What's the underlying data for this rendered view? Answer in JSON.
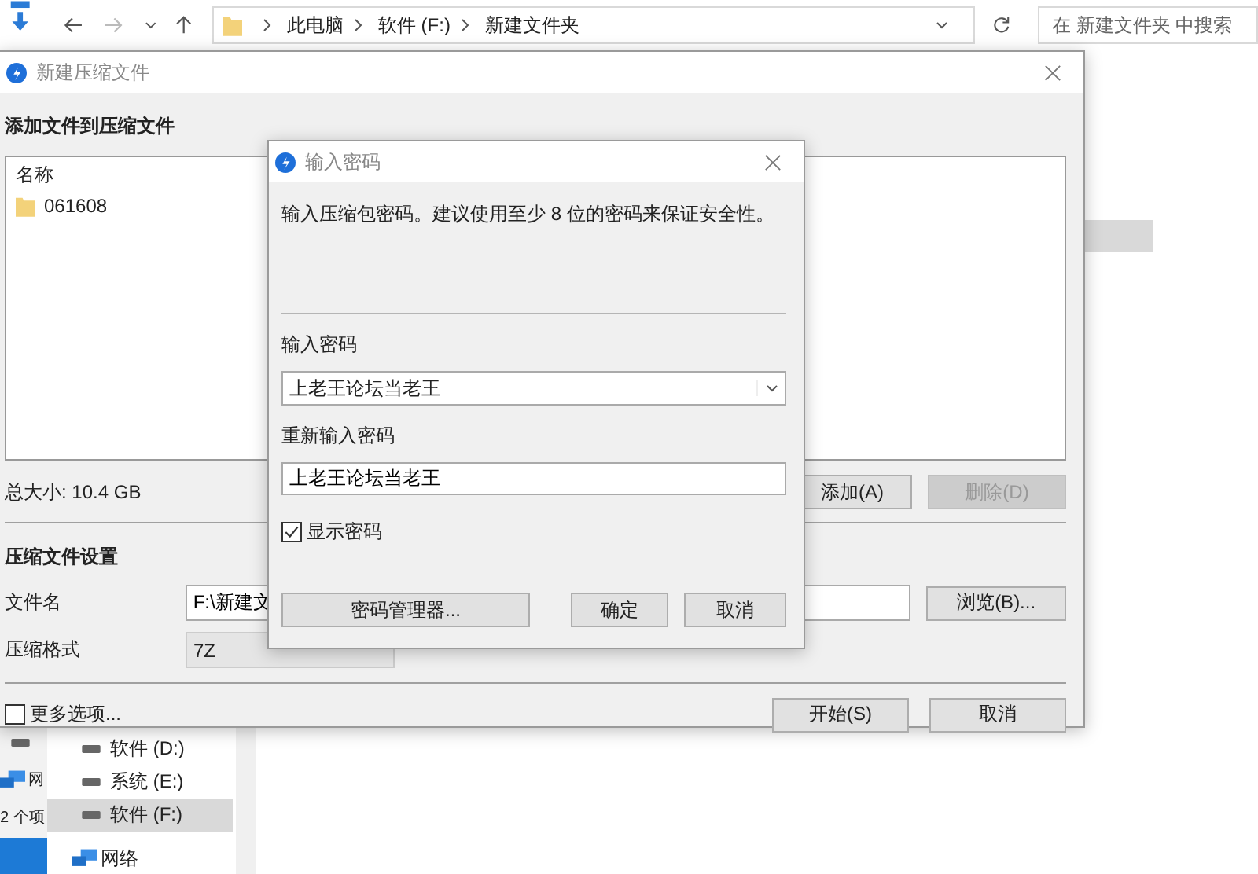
{
  "explorer": {
    "address_path": [
      "此电脑",
      "软件 (F:)",
      "新建文件夹"
    ],
    "search": {
      "placeholder": "在 新建文件夹 中搜索"
    },
    "nav_items": [
      {
        "label": "软件 (D:)",
        "selected": false
      },
      {
        "label": "系统 (E:)",
        "selected": false
      },
      {
        "label": "软件 (F:)",
        "selected": true
      }
    ],
    "network_label": "网络",
    "left_window": {
      "partial_label": "网",
      "status": "2 个项"
    }
  },
  "compress_dialog": {
    "title": "新建压缩文件",
    "heading": "添加文件到压缩文件",
    "file_list": {
      "columns": [
        "名称"
      ],
      "rows": [
        {
          "name": "061608"
        }
      ]
    },
    "total_size": "总大小: 10.4 GB",
    "list_buttons": [
      {
        "label": "添加(A)",
        "disabled": false
      },
      {
        "label": "删除(D)",
        "disabled": true
      }
    ],
    "settings_heading": "压缩文件设置",
    "filename": {
      "label": "文件名",
      "value": "F:\\新建文"
    },
    "browse_button": "浏览(B)...",
    "format": {
      "label": "压缩格式",
      "value": "7Z"
    },
    "more_options": {
      "label": "更多选项...",
      "checked": false
    },
    "buttons": [
      "开始(S)",
      "取消"
    ]
  },
  "password_dialog": {
    "title": "输入密码",
    "description": "输入压缩包密码。建议使用至少 8 位的密码来保证安全性。",
    "password": {
      "label": "输入密码",
      "value": "上老王论坛当老王"
    },
    "confirm": {
      "label": "重新输入密码",
      "value": "上老王论坛当老王"
    },
    "show_password": {
      "label": "显示密码",
      "checked": true
    },
    "buttons": [
      "密码管理器...",
      "确定",
      "取消"
    ]
  }
}
